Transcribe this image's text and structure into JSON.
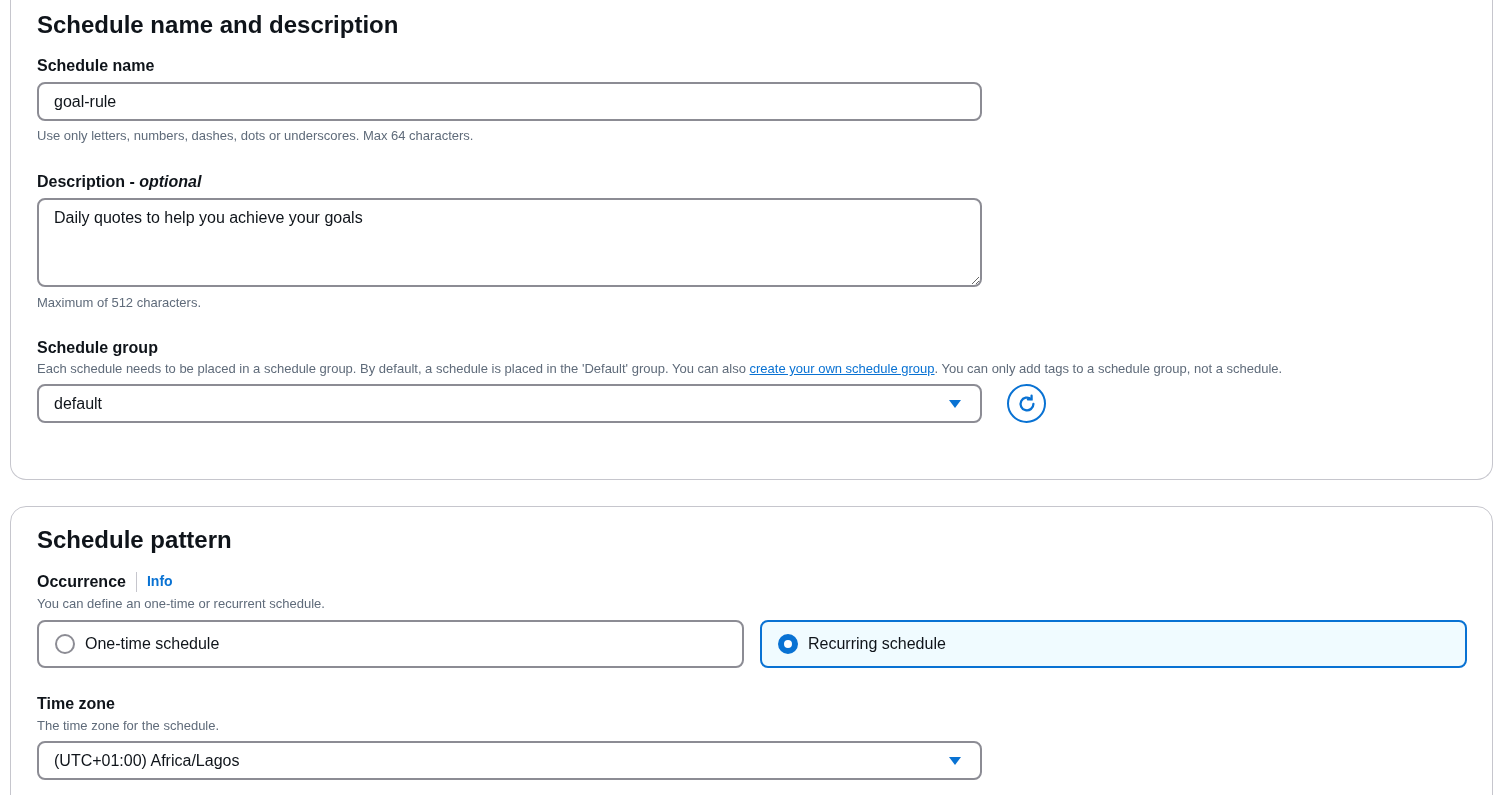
{
  "sections": [
    {
      "title": "Schedule name and description",
      "name_field": {
        "label": "Schedule name",
        "value": "goal-rule",
        "hint": "Use only letters, numbers, dashes, dots or underscores. Max 64 characters."
      },
      "description_field": {
        "label": "Description - *optional*",
        "value": "Daily quotes to help you achieve your goals",
        "hint": "Maximum of 512 characters."
      },
      "group_field": {
        "label": "Schedule group",
        "help_before": "Each schedule needs to be placed in a schedule group. By default, a schedule is placed in the 'Default' group. You can also ",
        "help_link": "create your own schedule group",
        "help_after": ". You can only add tags to a schedule group, not a schedule.",
        "value": "default"
      }
    },
    {
      "title": "Schedule pattern",
      "occurrence": {
        "label": "Occurrence",
        "info": "Info",
        "help": "You can define an one-time or recurrent schedule.",
        "options": [
          {
            "label": "One-time schedule",
            "selected": false
          },
          {
            "label": "Recurring schedule",
            "selected": true
          }
        ]
      },
      "timezone": {
        "label": "Time zone",
        "help": "The time zone for the schedule.",
        "value": "(UTC+01:00) Africa/Lagos"
      }
    }
  ]
}
